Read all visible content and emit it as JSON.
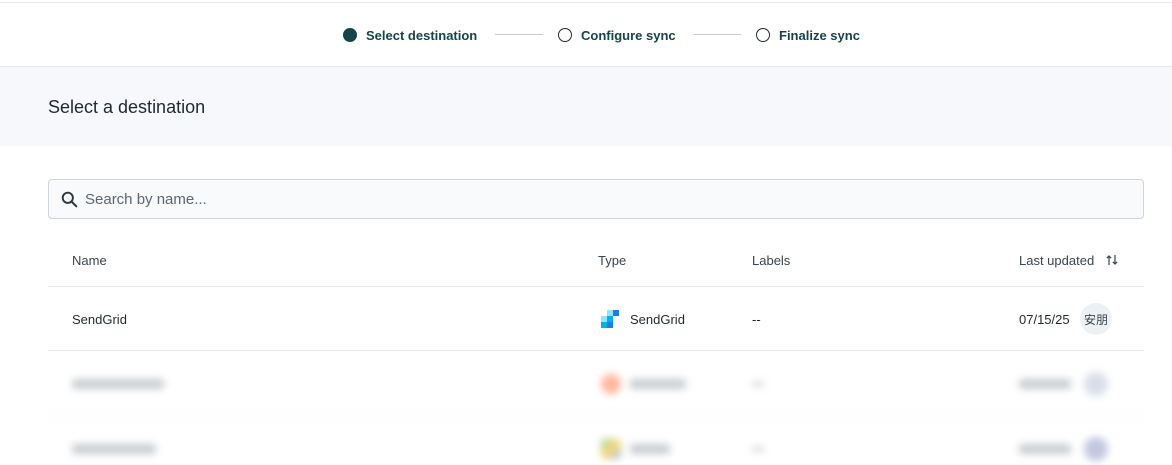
{
  "stepper": {
    "steps": [
      {
        "label": "Select destination",
        "state": "active"
      },
      {
        "label": "Configure sync",
        "state": "pending"
      },
      {
        "label": "Finalize sync",
        "state": "pending"
      }
    ]
  },
  "header": {
    "title": "Select a destination"
  },
  "search": {
    "placeholder": "Search by name...",
    "value": ""
  },
  "table": {
    "columns": {
      "name": "Name",
      "type": "Type",
      "labels": "Labels",
      "last_updated": "Last updated"
    },
    "rows": [
      {
        "name": "SendGrid",
        "type": "SendGrid",
        "type_icon": "sendgrid-logo-icon",
        "labels": "--",
        "last_updated": "07/15/25",
        "avatar": "安朋"
      }
    ]
  },
  "colors": {
    "accent": "#17434a",
    "header_band": "#f6f8fb",
    "sendgrid_blue": "#1a82e2",
    "sendgrid_light": "#99e1f4",
    "sendgrid_mid": "#00b3e3"
  }
}
